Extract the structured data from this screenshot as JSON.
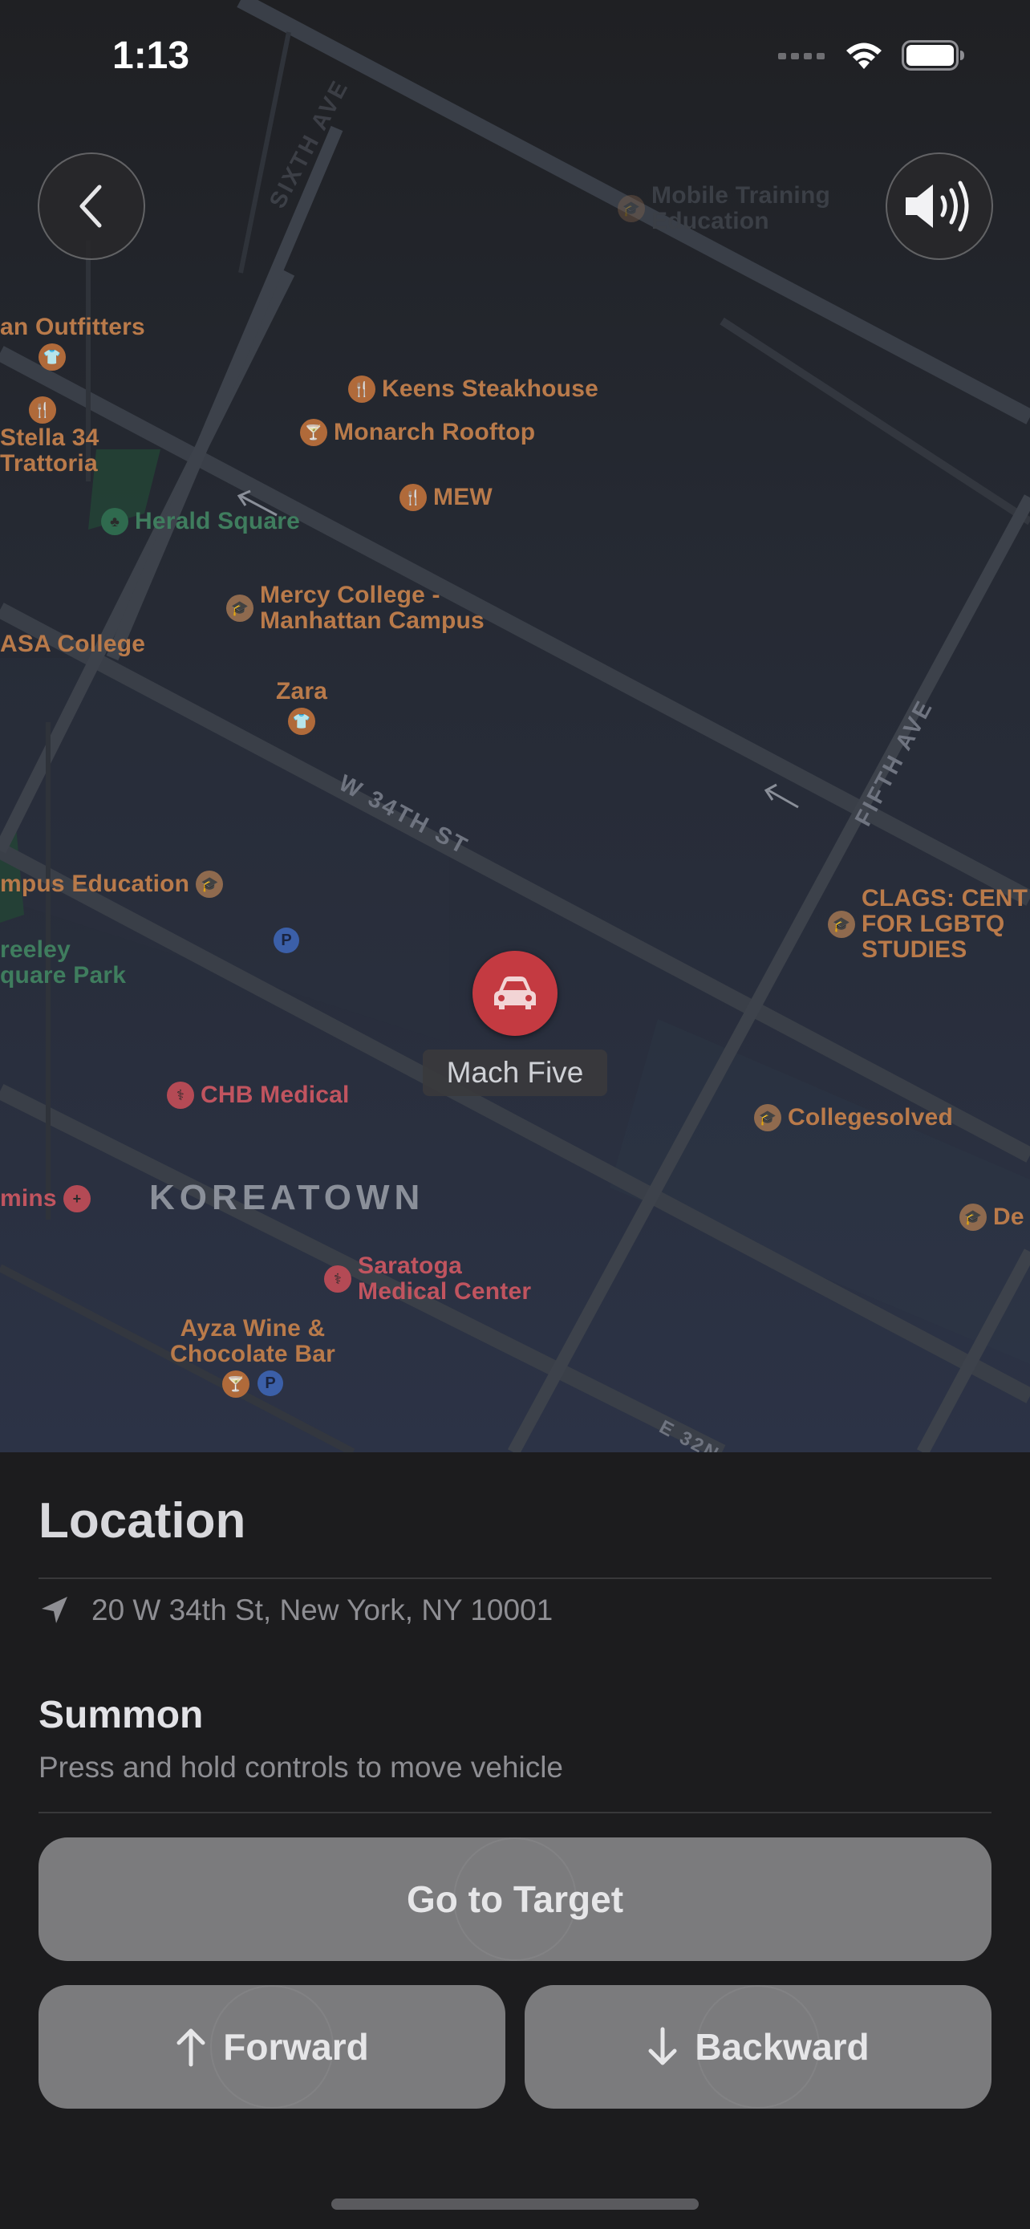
{
  "status_bar": {
    "time": "1:13"
  },
  "map": {
    "pois": [
      {
        "label": "Mobile Training\nEducation",
        "tone": "faint",
        "pin": "brown"
      },
      {
        "label": "an Outfitters",
        "tone": "orange",
        "pin": "orange"
      },
      {
        "label": "Keens Steakhouse",
        "tone": "orange",
        "pin": "orange"
      },
      {
        "label": "Stella 34\nTrattoria",
        "tone": "orange",
        "pin": "orange"
      },
      {
        "label": "Monarch Rooftop",
        "tone": "orange",
        "pin": "orange"
      },
      {
        "label": "MEW",
        "tone": "orange",
        "pin": "orange"
      },
      {
        "label": "Herald Square",
        "tone": "green",
        "pin": "green"
      },
      {
        "label": "Mercy College -\nManhattan Campus",
        "tone": "orange",
        "pin": "brown"
      },
      {
        "label": "ASA College",
        "tone": "orange",
        "pin": "brown"
      },
      {
        "label": "Zara",
        "tone": "orange",
        "pin": "orange"
      },
      {
        "label": "mpus Education",
        "tone": "orange",
        "pin": "brown"
      },
      {
        "label": "reeley\nquare Park",
        "tone": "green",
        "pin": "green"
      },
      {
        "label": "CLAGS: CENT\nFOR LGBTQ\nSTUDIES",
        "tone": "orange",
        "pin": "brown"
      },
      {
        "label": "CHB Medical",
        "tone": "red",
        "pin": "red"
      },
      {
        "label": "Collegesolved",
        "tone": "orange",
        "pin": "brown"
      },
      {
        "label": "mins",
        "tone": "red",
        "pin": "red"
      },
      {
        "label": "De",
        "tone": "orange",
        "pin": "brown"
      },
      {
        "label": "Saratoga\nMedical Center",
        "tone": "red",
        "pin": "red"
      },
      {
        "label": "Ayza Wine &\nChocolate Bar",
        "tone": "orange",
        "pin": "orange"
      }
    ],
    "streets": [
      "SIXTH AVE",
      "W 34TH ST",
      "FIFTH AVE",
      "E 32N"
    ],
    "district": "KOREATOWN",
    "parking_label": "P",
    "vehicle_label": "Mach Five"
  },
  "sheet": {
    "title": "Location",
    "address": "20 W 34th St, New York, NY 10001",
    "summon_title": "Summon",
    "summon_subtitle": "Press and hold controls to move vehicle",
    "go_to_target": "Go to Target",
    "forward": "Forward",
    "backward": "Backward"
  },
  "colors": {
    "accent_red": "#c43a41",
    "button_gray": "#7b7b7d",
    "sheet_bg": "#1c1c1e"
  }
}
